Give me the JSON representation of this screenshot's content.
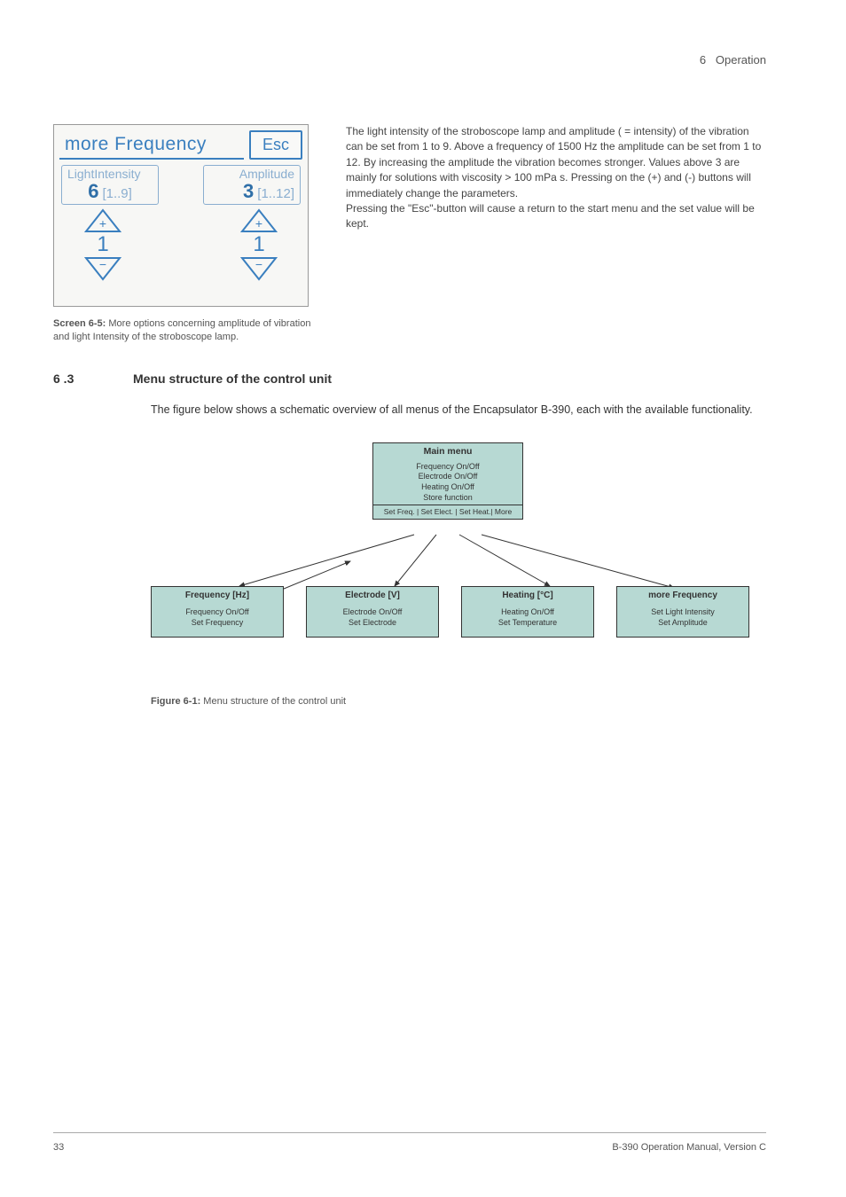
{
  "header": {
    "chapter_num": "6",
    "chapter_title": "Operation"
  },
  "screen": {
    "title": "more Frequency",
    "esc_label": "Esc",
    "left_param": {
      "label": "LightIntensity",
      "value": "6",
      "range": "[1..9]"
    },
    "right_param": {
      "label": "Amplitude",
      "value": "3",
      "range": "[1..12]"
    },
    "step_left": "1",
    "step_right": "1"
  },
  "paragraph_right": {
    "p1": "The light intensity of the stroboscope lamp and amplitude ( = intensity) of the vibration can be set from 1 to 9. Above a frequency of 1500 Hz the amplitude can be set from 1 to 12. By increasing the amplitude the vibration becomes stronger. Values above 3 are mainly for solutions with viscosity > 100 mPa s. Pressing on the (+) and (-) buttons will immediately change the parameters.",
    "p2": "Pressing the \"Esc\"-button will cause a return to the start menu and the set value will be kept."
  },
  "screen_caption": {
    "bold": "Screen 6-5:",
    "text": " More options concerning amplitude of vibration and light Intensity of the stroboscope lamp."
  },
  "section": {
    "num": "6 .3",
    "title": "Menu structure of the control unit"
  },
  "body_para": "The figure below shows a schematic overview of all menus of the Encapsulator B-390, each with the available functionality.",
  "diagram": {
    "main": {
      "title": "Main menu",
      "lines": [
        "Frequency On/Off",
        "Electrode On/Off",
        "Heating On/Off",
        "Store function"
      ],
      "foot": "Set Freq. | Set Elect. | Set Heat.| More"
    },
    "sub": [
      {
        "title": "Frequency [Hz]",
        "lines": [
          "Frequency On/Off",
          "Set Frequency"
        ]
      },
      {
        "title": "Electrode [V]",
        "lines": [
          "Electrode On/Off",
          "Set Electrode"
        ]
      },
      {
        "title": "Heating [°C]",
        "lines": [
          "Heating On/Off",
          "Set Temperature"
        ]
      },
      {
        "title": "more Frequency",
        "lines": [
          "Set Light Intensity",
          "Set Amplitude"
        ]
      }
    ]
  },
  "figure_caption": {
    "bold": "Figure 6-1:",
    "text": " Menu structure of the control unit"
  },
  "footer": {
    "page": "33",
    "doc": "B-390 Operation Manual, Version C"
  }
}
